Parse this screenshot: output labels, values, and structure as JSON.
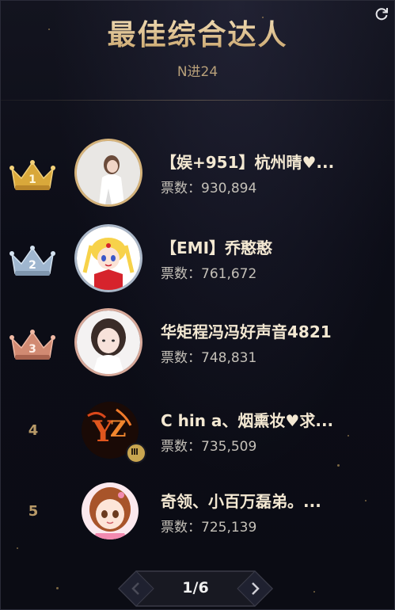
{
  "header": {
    "title": "最佳综合达人",
    "subtitle": "N进24"
  },
  "colors": {
    "background": "#0e0f1a",
    "title_gold": "#e8cfa0",
    "subtitle": "#b8a07a",
    "name_text": "#f3e8d2",
    "votes_text": "#c4c0b8",
    "rank_text": "#b89a68",
    "crown_gold": "#d9a83a",
    "crown_silver": "#9fb6cf",
    "crown_bronze": "#d18a72"
  },
  "votes_label": "票数：",
  "ranking": [
    {
      "rank": "1",
      "crown": "gold",
      "name": "【娱+951】杭州晴♥...",
      "votes": "930,894"
    },
    {
      "rank": "2",
      "crown": "silver",
      "name": "【EMI】乔憨憨",
      "votes": "761,672"
    },
    {
      "rank": "3",
      "crown": "bronze",
      "name": "华矩程冯冯好声音4821",
      "votes": "748,831"
    },
    {
      "rank": "4",
      "crown": "none",
      "name": "C hin a、烟熏妆♥求...",
      "votes": "735,509"
    },
    {
      "rank": "5",
      "crown": "none",
      "name": "奇领、小百万磊弟。...",
      "votes": "725,139"
    }
  ],
  "pagination": {
    "current": "1",
    "total": "/6"
  },
  "icons": {
    "refresh": "refresh-icon",
    "prev": "chevron-left-icon",
    "next": "chevron-right-icon",
    "crown": "crown-icon",
    "level_badge": "level-badge-icon"
  }
}
